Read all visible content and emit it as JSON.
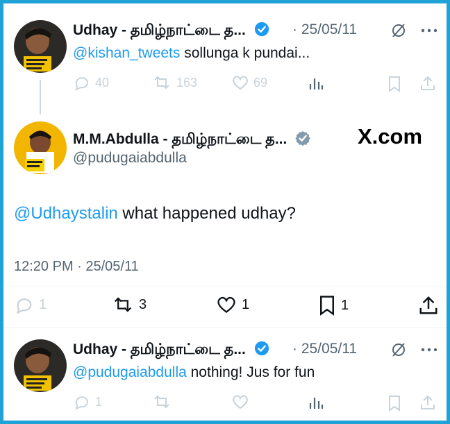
{
  "tweet1": {
    "name": "Udhay - தமிழ்நாட்டை த...",
    "date": "25/05/11",
    "mention": "@kishan_tweets",
    "text": " sollunga k pundai...",
    "replies": "40",
    "retweets": "163",
    "likes": "69"
  },
  "tweet2": {
    "name": "M.M.Abdulla - தமிழ்நாட்டை த...",
    "handle": "@pudugaiabdulla",
    "watermark": "X.com",
    "mention": "@Udhaystalin",
    "text": " what happened udhay?",
    "timestamp": "12:20 PM · 25/05/11",
    "replies": "1",
    "retweets": "3",
    "likes": "1",
    "bookmarks": "1"
  },
  "tweet3": {
    "name": "Udhay - தமிழ்நாட்டை த...",
    "date": "25/05/11",
    "mention": "@pudugaiabdulla",
    "text": " nothing! Jus for fun",
    "replies": "1"
  },
  "colors": {
    "border": "#1fa3d6",
    "link": "#1d9bf0",
    "verified": "#1d9bf0",
    "muted": "#536471"
  }
}
